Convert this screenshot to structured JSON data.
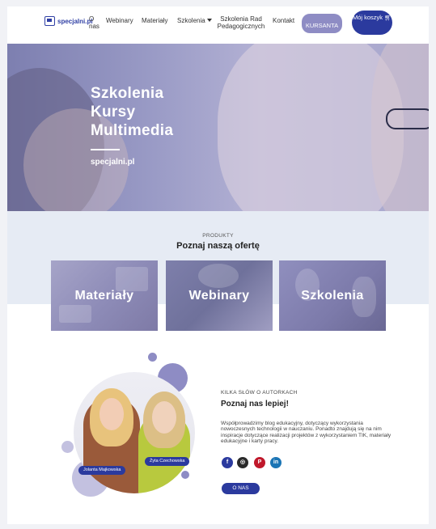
{
  "header": {
    "logo_text": "specjalni.pl",
    "nav": {
      "o_nas": "O nas",
      "webinary": "Webinary",
      "materialy": "Materiały",
      "szkolenia": "Szkolenia",
      "szkolenia_rad": "Szkolenia Rad Pedagogicznych",
      "kontakt": "Kontakt"
    },
    "kursanta_label": "KURSANTA",
    "koszyk_label": "Mój koszyk"
  },
  "hero": {
    "line1": "Szkolenia",
    "line2": "Kursy",
    "line3": "Multimedia",
    "site": "specjalni.pl"
  },
  "products": {
    "kicker": "PRODUKTY",
    "title": "Poznaj naszą ofertę",
    "cards": [
      "Materiały",
      "Webinary",
      "Szkolenia"
    ]
  },
  "authors": {
    "kicker": "KILKA SŁÓW O AUTORKACH",
    "title": "Poznaj nas lepiej!",
    "text": "Współprowadzimy blog edukacyjny, dotyczący wykorzystania nowoczesnych technologii w nauczaniu. Ponadto znajdują się na nim inspiracje dotyczące realizacji projektów z wykorzystaniem TIK, materiały edukacyjne i karty pracy.",
    "name1": "Jolanta Majkowska",
    "name2": "Żyta Czechowska",
    "social": {
      "facebook": "f",
      "instagram": "◎",
      "pinterest": "P",
      "linkedin": "in"
    },
    "button": "O NAS"
  },
  "colors": {
    "brand": "#2b3a9e",
    "accent": "#8e8cc4",
    "band": "#e6ebf4"
  }
}
